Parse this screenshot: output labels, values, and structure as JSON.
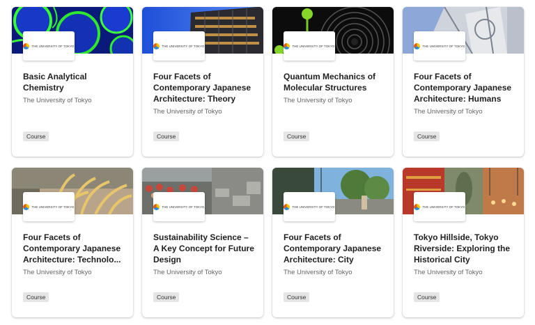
{
  "courses": [
    {
      "title": "Basic Analytical Chemistry",
      "partner": "The University of Tokyo",
      "type": "Course",
      "logo_text": "THE UNIVERSITY OF TOKYO"
    },
    {
      "title": "Four Facets of Contemporary Japanese Architecture: Theory",
      "partner": "The University of Tokyo",
      "type": "Course",
      "logo_text": "THE UNIVERSITY OF TOKYO"
    },
    {
      "title": "Quantum Mechanics of Molecular Structures",
      "partner": "The University of Tokyo",
      "type": "Course",
      "logo_text": "THE UNIVERSITY OF TOKYO"
    },
    {
      "title": "Four Facets of Contemporary Japanese Architecture: Humans",
      "partner": "The University of Tokyo",
      "type": "Course",
      "logo_text": "THE UNIVERSITY OF TOKYO"
    },
    {
      "title": "Four Facets of Contemporary Japanese Architecture: Technolo...",
      "partner": "The University of Tokyo",
      "type": "Course",
      "logo_text": "THE UNIVERSITY OF TOKYO"
    },
    {
      "title": "Sustainability Science – A Key Concept for Future Design",
      "partner": "The University of Tokyo",
      "type": "Course",
      "logo_text": "THE UNIVERSITY OF TOKYO"
    },
    {
      "title": "Four Facets of Contemporary Japanese Architecture: City",
      "partner": "The University of Tokyo",
      "type": "Course",
      "logo_text": "THE UNIVERSITY OF TOKYO"
    },
    {
      "title": "Tokyo Hillside, Tokyo Riverside: Exploring the Historical City",
      "partner": "The University of Tokyo",
      "type": "Course",
      "logo_text": "THE UNIVERSITY OF TOKYO"
    }
  ],
  "colors": {
    "title": "#1f1f1f",
    "partner": "#636363",
    "badge_bg": "#e5e5e5"
  }
}
